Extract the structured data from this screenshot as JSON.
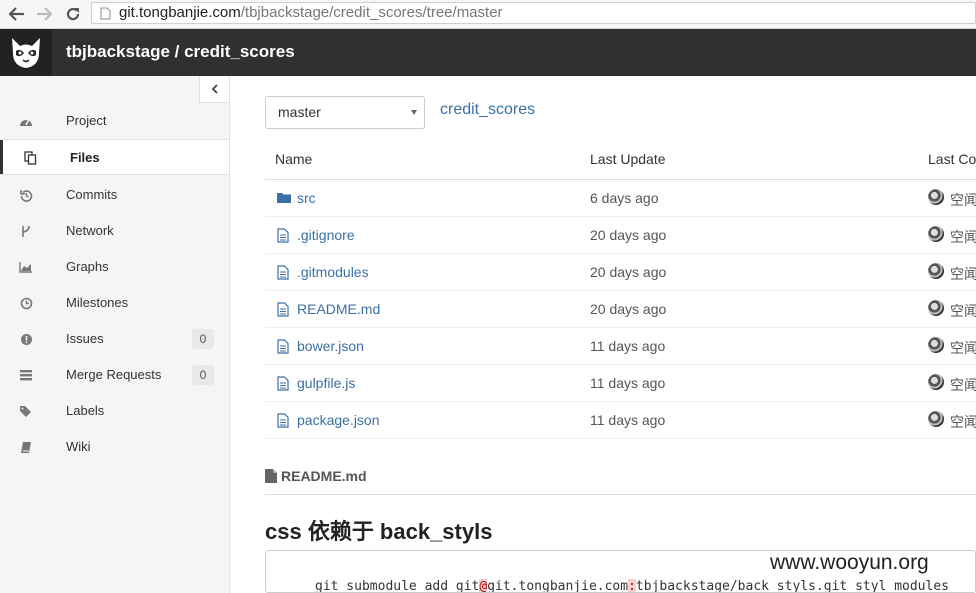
{
  "browser": {
    "url_host": "git.tongbanjie.com",
    "url_path": "/tbjbackstage/credit_scores/tree/master"
  },
  "header": {
    "title": "tbjbackstage / credit_scores"
  },
  "sidebar": {
    "collapse_icon": "chevron-left-icon",
    "items": [
      {
        "label": "Project",
        "icon": "dashboard-icon"
      },
      {
        "label": "Files",
        "icon": "files-icon",
        "active": true
      },
      {
        "label": "Commits",
        "icon": "history-icon"
      },
      {
        "label": "Network",
        "icon": "code-fork-icon"
      },
      {
        "label": "Graphs",
        "icon": "area-chart-icon"
      },
      {
        "label": "Milestones",
        "icon": "clock-icon"
      },
      {
        "label": "Issues",
        "icon": "exclamation-circle-icon",
        "count": "0"
      },
      {
        "label": "Merge Requests",
        "icon": "tasks-icon",
        "count": "0"
      },
      {
        "label": "Labels",
        "icon": "tags-icon"
      },
      {
        "label": "Wiki",
        "icon": "book-icon"
      }
    ]
  },
  "main": {
    "branch": "master",
    "repo_link": "credit_scores",
    "table": {
      "headers": {
        "name": "Name",
        "last_update": "Last Update",
        "last_commit": "Last Co"
      },
      "rows": [
        {
          "name": "src",
          "type": "folder",
          "date": "6 days ago",
          "author": "空闻"
        },
        {
          "name": ".gitignore",
          "type": "file",
          "date": "20 days ago",
          "author": "空闻"
        },
        {
          "name": ".gitmodules",
          "type": "file",
          "date": "20 days ago",
          "author": "空闻"
        },
        {
          "name": "README.md",
          "type": "file",
          "date": "20 days ago",
          "author": "空闻"
        },
        {
          "name": "bower.json",
          "type": "file",
          "date": "11 days ago",
          "author": "空闻"
        },
        {
          "name": "gulpfile.js",
          "type": "file",
          "date": "11 days ago",
          "author": "空闻"
        },
        {
          "name": "package.json",
          "type": "file",
          "date": "11 days ago",
          "author": "空闻"
        }
      ]
    },
    "readme": {
      "title": "README.md",
      "heading": "css 依赖于 back_styls",
      "code_part1": "git submodule add git",
      "code_at": "@",
      "code_part2": "git.tongbanjie.com",
      "code_colon": ":",
      "code_part3": "tbjbackstage/back_styls.git styl_modules"
    }
  },
  "watermark": "www.wooyun.org",
  "colors": {
    "link": "#3c70a4",
    "header_bg": "#303030",
    "sidebar_bg": "#f5f5f5"
  }
}
